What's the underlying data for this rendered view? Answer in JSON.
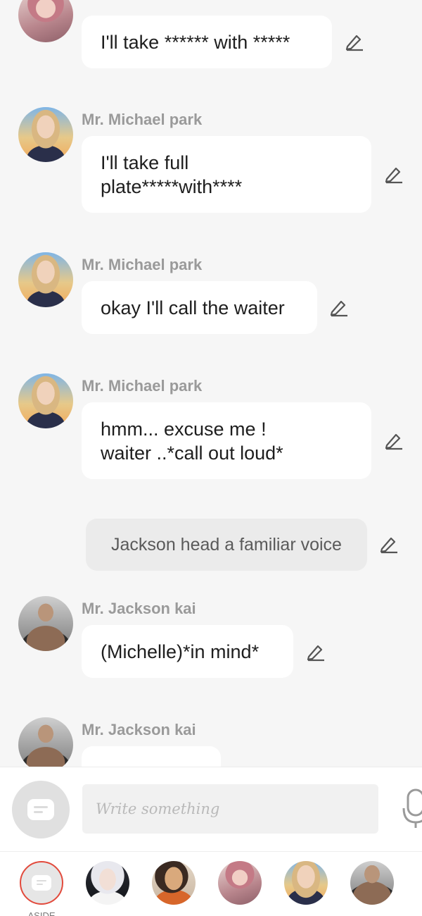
{
  "messages": [
    {
      "sender": "",
      "text": "I'll take ****** with *****",
      "avatar": "pink-hair-avatar"
    },
    {
      "sender": "Mr. Michael park",
      "text": "I'll  take full plate*****with****",
      "avatar": "michael-avatar"
    },
    {
      "sender": "Mr. Michael park",
      "text": "okay I'll call the waiter",
      "avatar": "michael-avatar"
    },
    {
      "sender": "Mr. Michael park",
      "text": "hmm... excuse me ! waiter ..*call out loud*",
      "avatar": "michael-avatar"
    },
    {
      "sender": "",
      "text": "Jackson head a familiar voice",
      "type": "narration"
    },
    {
      "sender": "Mr. Jackson kai",
      "text": "(Michelle)*in mind*",
      "avatar": "jackson-avatar"
    },
    {
      "sender": "Mr. Jackson kai",
      "text": "",
      "avatar": "jackson-avatar"
    }
  ],
  "input": {
    "placeholder": "Write something"
  },
  "character_strip": [
    {
      "label": "ASIDE",
      "icon": "chat-bubble-icon"
    },
    {
      "label": "",
      "icon": "white-hair-avatar"
    },
    {
      "label": "",
      "icon": "dark-hair-avatar"
    },
    {
      "label": "",
      "icon": "pink-hair-avatar"
    },
    {
      "label": "",
      "icon": "michael-avatar"
    },
    {
      "label": "",
      "icon": "jackson-avatar"
    }
  ],
  "colors": {
    "background": "#f6f6f6",
    "bubble": "#ffffff",
    "narration_bubble": "#ebebeb",
    "sender_text": "#9a9a9a",
    "accent_ring": "#e24a3c"
  }
}
